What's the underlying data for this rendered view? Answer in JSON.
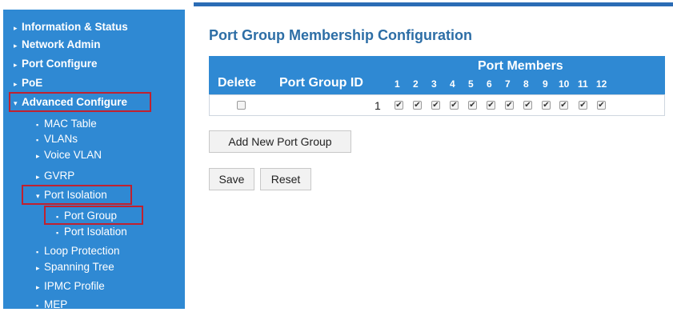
{
  "sidebar": {
    "items": [
      {
        "marker": "▸",
        "label": "Information & Status"
      },
      {
        "marker": "▸",
        "label": "Network Admin"
      },
      {
        "marker": "▸",
        "label": "Port Configure"
      },
      {
        "marker": "▸",
        "label": "PoE"
      },
      {
        "marker": "▾",
        "label": "Advanced Configure"
      },
      {
        "marker": "▪",
        "label": "MAC Table"
      },
      {
        "marker": "▪",
        "label": "VLANs"
      },
      {
        "marker": "▸",
        "label": "Voice VLAN"
      },
      {
        "marker": "▸",
        "label": "GVRP"
      },
      {
        "marker": "▾",
        "label": "Port Isolation"
      },
      {
        "marker": "▪",
        "label": "Port Group"
      },
      {
        "marker": "▪",
        "label": "Port Isolation"
      },
      {
        "marker": "▪",
        "label": "Loop Protection"
      },
      {
        "marker": "▸",
        "label": "Spanning Tree"
      },
      {
        "marker": "▸",
        "label": "IPMC Profile"
      },
      {
        "marker": "▪",
        "label": "MEP"
      }
    ]
  },
  "main": {
    "title": "Port Group Membership Configuration",
    "table": {
      "group_header": "Port Members",
      "col_delete": "Delete",
      "col_group_id": "Port Group ID",
      "ports": [
        "1",
        "2",
        "3",
        "4",
        "5",
        "6",
        "7",
        "8",
        "9",
        "10",
        "11",
        "12"
      ],
      "rows": [
        {
          "delete_checked": false,
          "group_id": "1",
          "members": [
            true,
            true,
            true,
            true,
            true,
            true,
            true,
            true,
            true,
            true,
            true,
            true
          ]
        }
      ]
    },
    "add_button": "Add New Port Group",
    "save_button": "Save",
    "reset_button": "Reset"
  },
  "colors": {
    "sidebar_bg": "#2f89d3",
    "title": "#2d6ea6",
    "table_header_bg": "#2f89d3",
    "highlight_border": "#c0212f"
  }
}
